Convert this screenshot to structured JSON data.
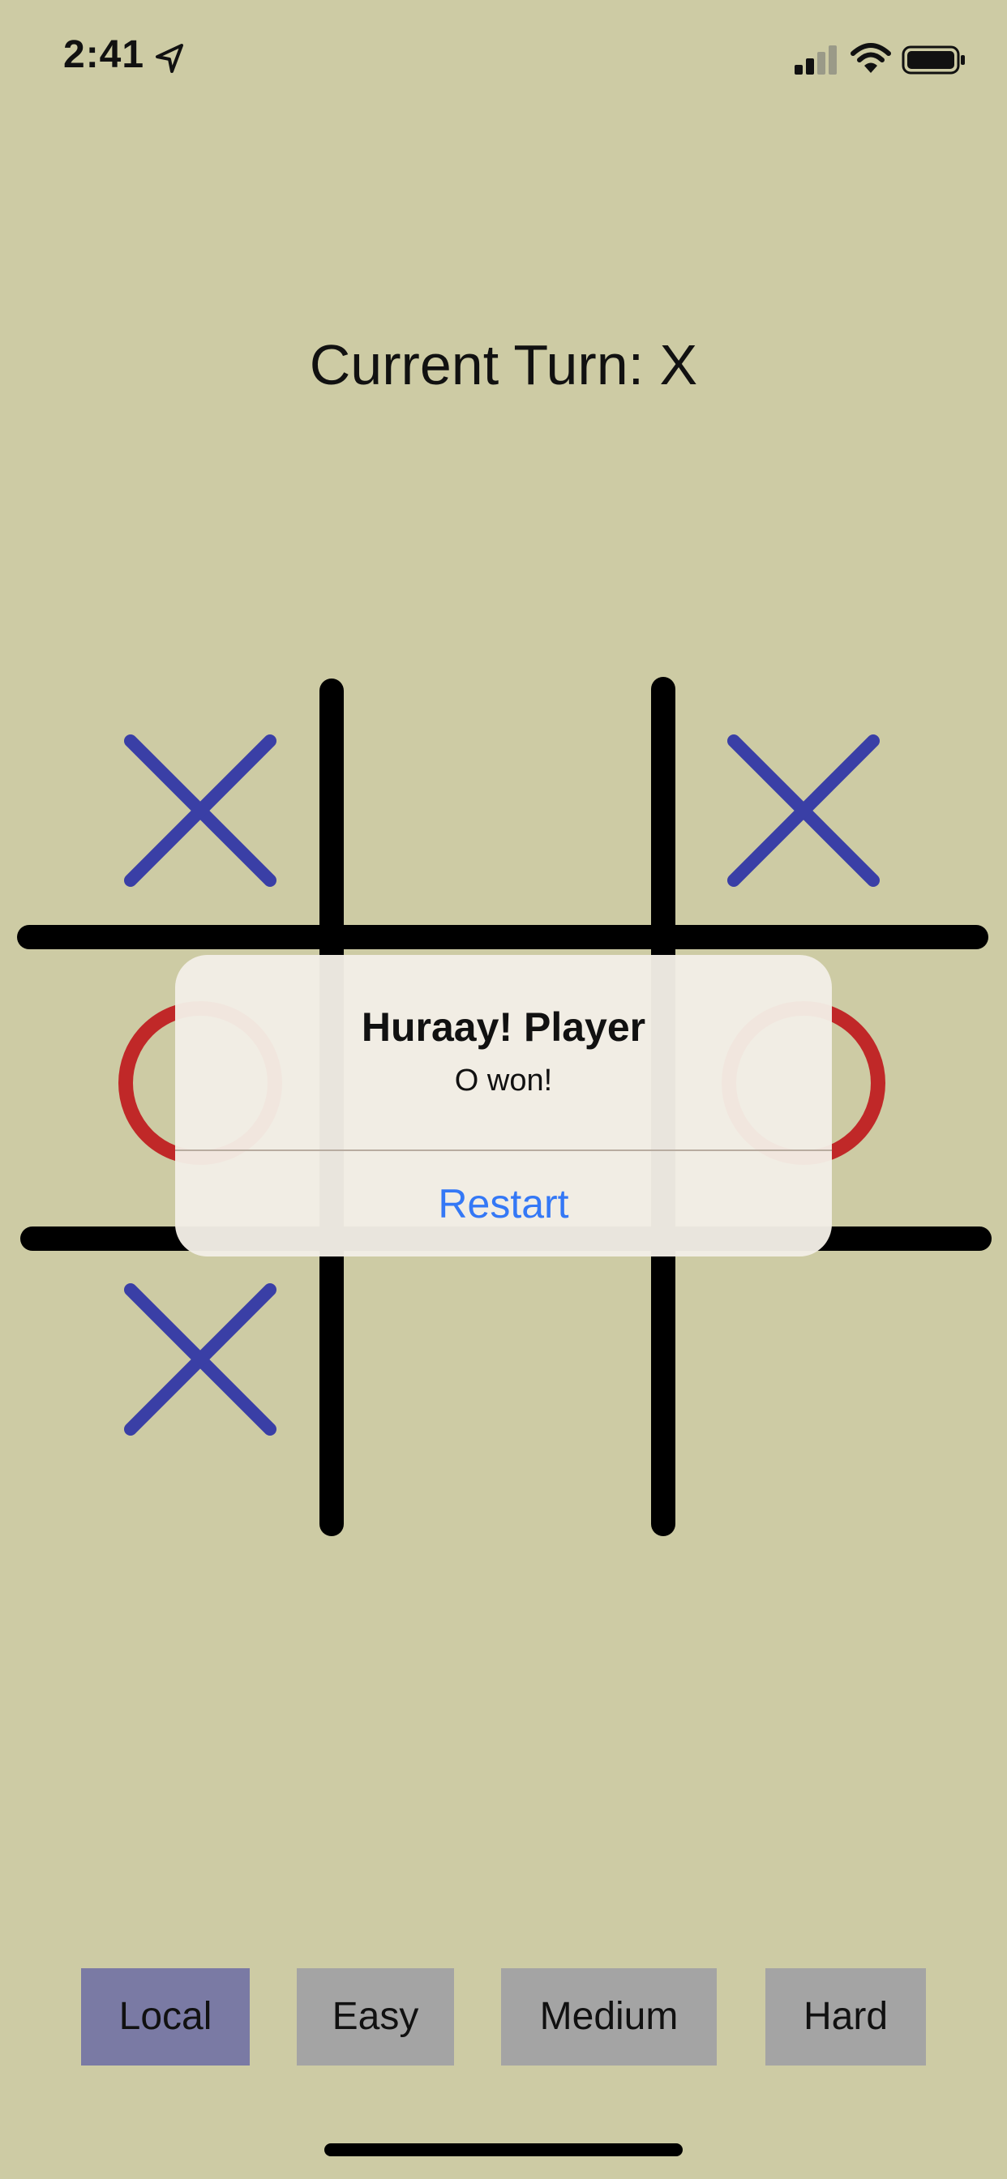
{
  "status_bar": {
    "time": "2:41",
    "location_icon": "location-arrow-icon",
    "signal_icon": "cellular-signal-icon",
    "wifi_icon": "wifi-icon",
    "battery_icon": "battery-icon"
  },
  "game": {
    "turn_text": "Current Turn: X",
    "board": [
      [
        "X",
        "",
        "X"
      ],
      [
        "O",
        "",
        "O"
      ],
      [
        "X",
        "",
        ""
      ]
    ],
    "colors": {
      "background": "#cdcba4",
      "x_mark": "#3a3fa6",
      "o_mark": "#c02828",
      "grid": "#000000"
    }
  },
  "alert": {
    "title": "Huraay! Player",
    "message": "O won!",
    "button_label": "Restart",
    "button_color": "#3478f6"
  },
  "modes": {
    "buttons": [
      {
        "label": "Local",
        "active": true
      },
      {
        "label": "Easy",
        "active": false
      },
      {
        "label": "Medium",
        "active": false
      },
      {
        "label": "Hard",
        "active": false
      }
    ],
    "active_color": "#7a7aa4",
    "inactive_color": "#a4a4a4"
  }
}
